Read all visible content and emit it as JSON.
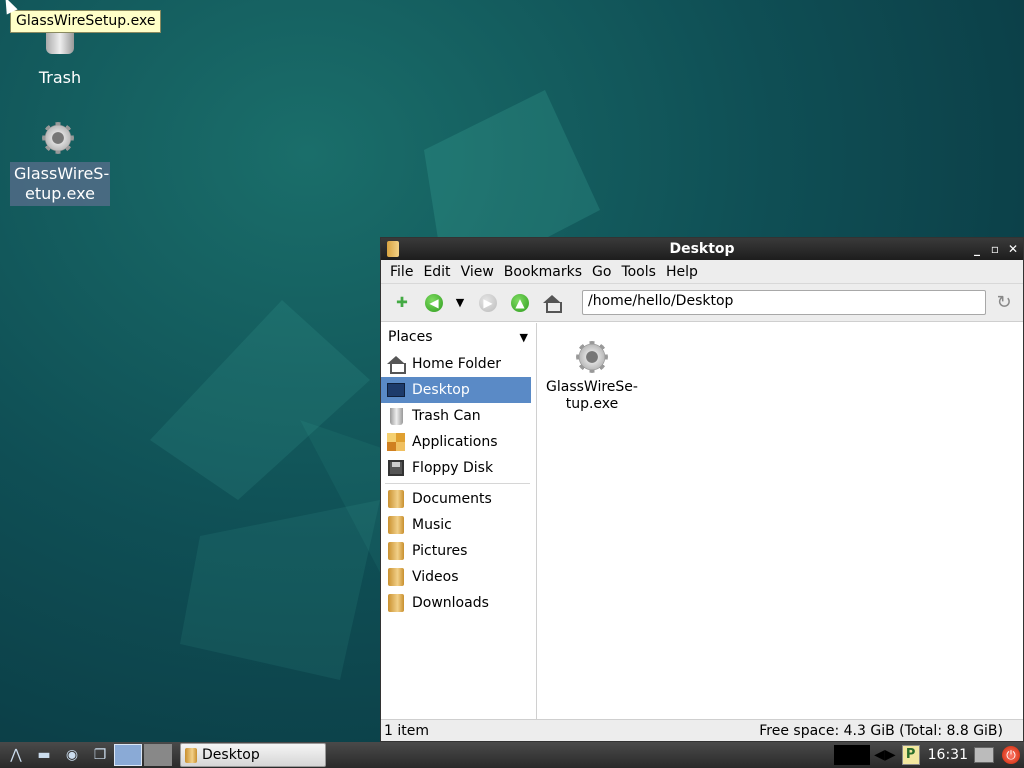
{
  "tooltip": {
    "text": "GlassWireSetup.exe"
  },
  "desktop_icons": [
    {
      "label": "Trash",
      "icon": "trash-icon"
    },
    {
      "label_line1": "GlassWireS-",
      "label_line2": "etup.exe",
      "icon": "gear-icon"
    }
  ],
  "window": {
    "title": "Desktop",
    "menu": [
      "File",
      "Edit",
      "View",
      "Bookmarks",
      "Go",
      "Tools",
      "Help"
    ],
    "address": "/home/hello/Desktop",
    "sidebar": {
      "header": "Places",
      "places": [
        {
          "label": "Home Folder",
          "icon": "home-folder-icon"
        },
        {
          "label": "Desktop",
          "icon": "desktop-icon",
          "active": true
        },
        {
          "label": "Trash Can",
          "icon": "trash-can-icon"
        },
        {
          "label": "Applications",
          "icon": "applications-icon"
        },
        {
          "label": "Floppy Disk",
          "icon": "floppy-disk-icon"
        }
      ],
      "bookmarks": [
        {
          "label": "Documents",
          "icon": "folder-icon"
        },
        {
          "label": "Music",
          "icon": "folder-icon"
        },
        {
          "label": "Pictures",
          "icon": "folder-icon"
        },
        {
          "label": "Videos",
          "icon": "folder-icon"
        },
        {
          "label": "Downloads",
          "icon": "folder-icon"
        }
      ]
    },
    "files": [
      {
        "line1": "GlassWireSe-",
        "line2": "tup.exe",
        "icon": "gear-icon"
      }
    ],
    "status": {
      "count": "1 item",
      "free_space": "Free space: 4.3 GiB (Total: 8.8 GiB)"
    }
  },
  "taskbar": {
    "task_label": "Desktop",
    "clock": "16:31",
    "tray_p": "P",
    "pager_active_color": "#8aaad6"
  }
}
